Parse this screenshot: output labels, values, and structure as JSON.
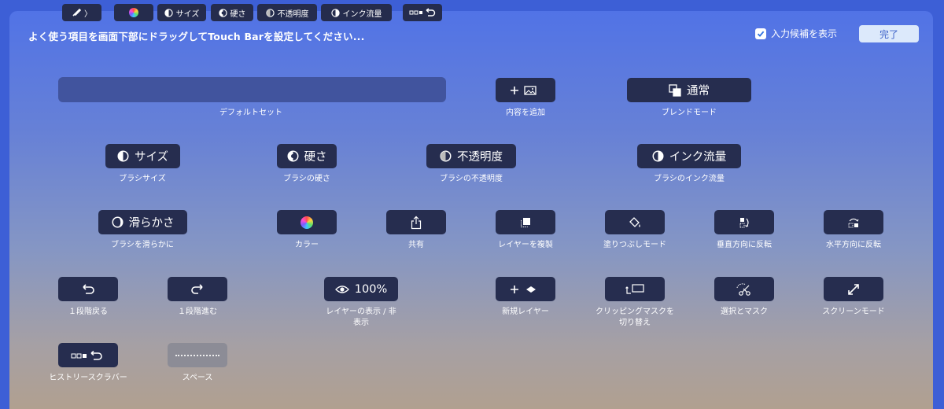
{
  "header": {
    "instruction": "よく使う項目を画面下部にドラッグしてTouch Barを設定してください...",
    "suggest_label": "入力候補を表示",
    "suggest_checked": true,
    "done_label": "完了"
  },
  "default_set": {
    "caption": "デフォルトセット",
    "items": {
      "brush": "〉",
      "size": "サイズ",
      "hardness": "硬さ",
      "opacity": "不透明度",
      "flow": "インク流量"
    }
  },
  "items": {
    "add_content": {
      "caption": "内容を追加"
    },
    "blend": {
      "label": "通常",
      "caption": "ブレンドモード"
    },
    "size": {
      "label": "サイズ",
      "caption": "ブラシサイズ"
    },
    "hardness": {
      "label": "硬さ",
      "caption": "ブラシの硬さ"
    },
    "opacity": {
      "label": "不透明度",
      "caption": "ブラシの不透明度"
    },
    "flow": {
      "label": "インク流量",
      "caption": "ブラシのインク流量"
    },
    "smoothing": {
      "label": "滑らかさ",
      "caption": "ブラシを滑らかに"
    },
    "color": {
      "caption": "カラー"
    },
    "share": {
      "caption": "共有"
    },
    "duplicate": {
      "caption": "レイヤーを複製"
    },
    "fill": {
      "caption": "塗りつぶしモード"
    },
    "flip_v": {
      "caption": "垂直方向に反転"
    },
    "flip_h": {
      "caption": "水平方向に反転"
    },
    "undo": {
      "caption": "１段階戻る"
    },
    "redo": {
      "caption": "１段階進む"
    },
    "visibility": {
      "label": "100%",
      "caption_line1": "レイヤーの表示 / 非",
      "caption_line2": "表示"
    },
    "new_layer": {
      "caption": "新規レイヤー"
    },
    "clipping": {
      "caption_line1": "クリッピングマスクを",
      "caption_line2": "切り替え"
    },
    "select_mask": {
      "caption": "選択とマスク"
    },
    "screen_mode": {
      "caption": "スクリーンモード"
    },
    "history": {
      "caption": "ヒストリースクラバー"
    },
    "space": {
      "caption": "スペース"
    }
  },
  "colors": {
    "key_bg": "#262d4f",
    "default_set_bg": "#41549e",
    "done_bg": "#dce9fb",
    "done_text": "#3d62c8"
  }
}
